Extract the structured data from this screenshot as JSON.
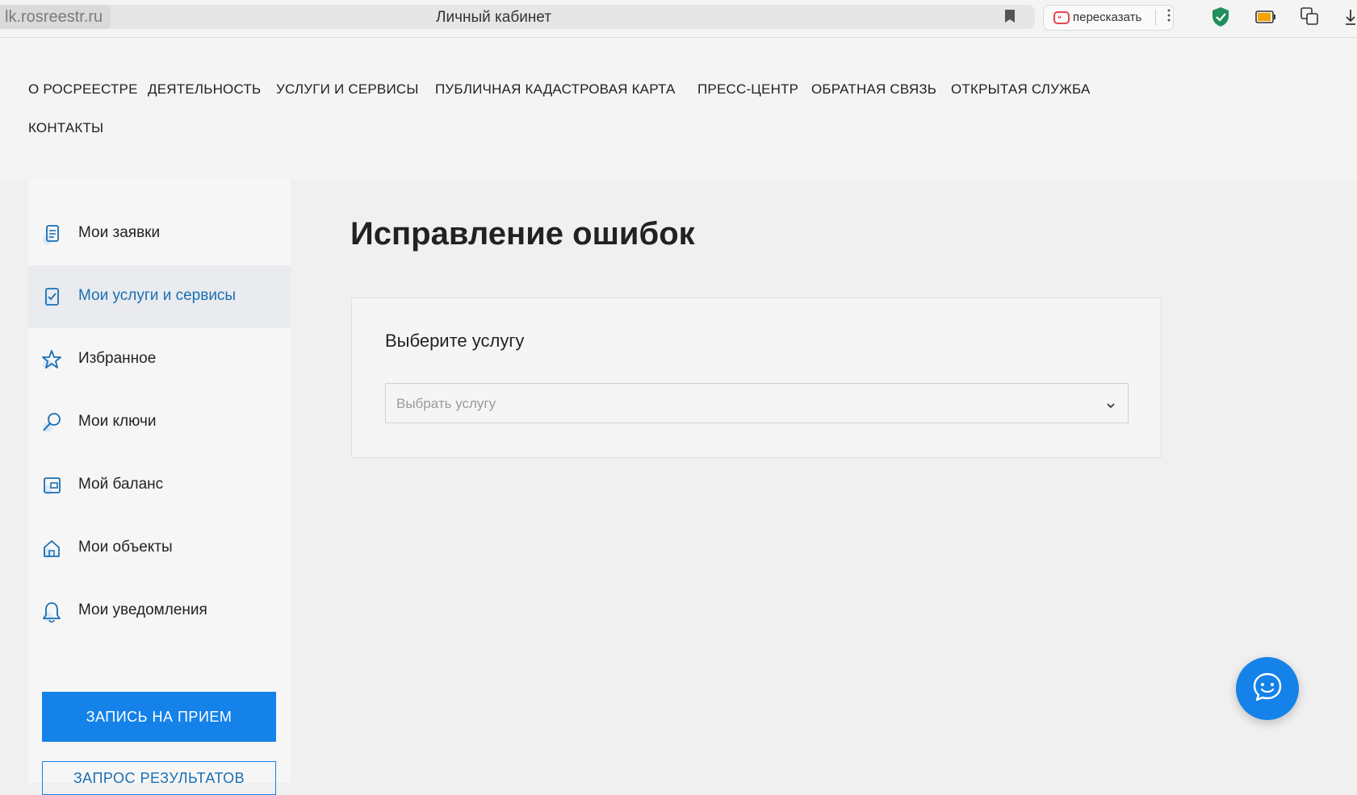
{
  "browser": {
    "domain": "lk.rosreestr.ru",
    "page_title": "Личный кабинет",
    "retell_label": "пересказать",
    "icons": [
      "bookmark-icon",
      "retell-icon",
      "kebab-menu-icon",
      "shield-icon",
      "battery-icon",
      "translate-icon",
      "download-icon"
    ]
  },
  "nav": {
    "items": [
      "О РОСРЕЕСТРЕ",
      "ДЕЯТЕЛЬНОСТЬ",
      "УСЛУГИ И СЕРВИСЫ",
      "ПУБЛИЧНАЯ КАДАСТРОВАЯ КАРТА",
      "ПРЕСС-ЦЕНТР",
      "ОБРАТНАЯ СВЯЗЬ",
      "ОТКРЫТАЯ СЛУЖБА",
      "КОНТАКТЫ"
    ]
  },
  "sidebar": {
    "items": [
      {
        "label": "Мои заявки",
        "icon": "document-icon",
        "active": false
      },
      {
        "label": "Мои услуги и сервисы",
        "icon": "checklist-icon",
        "active": true
      },
      {
        "label": "Избранное",
        "icon": "star-icon",
        "active": false
      },
      {
        "label": "Мои ключи",
        "icon": "key-icon",
        "active": false
      },
      {
        "label": "Мой баланс",
        "icon": "wallet-icon",
        "active": false
      },
      {
        "label": "Мои объекты",
        "icon": "house-icon",
        "active": false
      },
      {
        "label": "Мои уведомления",
        "icon": "bell-icon",
        "active": false
      }
    ],
    "appointment_button": "ЗАПИСЬ НА ПРИЕМ",
    "results_button": "ЗАПРОС РЕЗУЛЬТАТОВ"
  },
  "main": {
    "title": "Исправление ошибок",
    "card_heading": "Выберите услугу",
    "select_placeholder": "Выбрать услугу"
  },
  "colors": {
    "accent": "#1482e8",
    "active_text": "#1a6fb3",
    "page_bg": "#f0f0f0"
  },
  "chat": {
    "icon": "chat-smile-icon"
  }
}
